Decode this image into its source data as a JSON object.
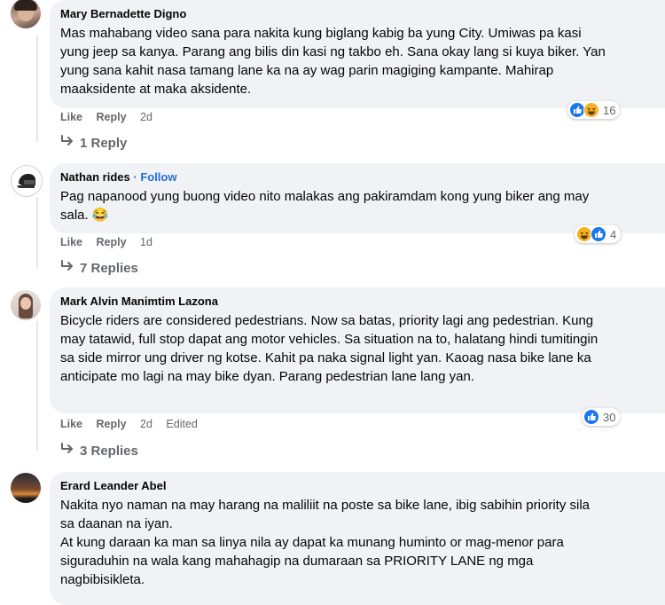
{
  "comments": [
    {
      "author": "Mary Bernadette Digno",
      "follow": "",
      "text": "Mas mahabang video sana para nakita kung biglang kabig ba yung City. Umiwas pa kasi yung jeep sa kanya. Parang ang bilis din kasi ng takbo eh. Sana okay lang si kuya biker. Yan yung sana kahit nasa tamang lane ka na ay wag parin magiging kampante. Mahirap maaksidente at maka aksidente.",
      "like_label": "Like",
      "reply_label": "Reply",
      "time": "2d",
      "edited": "",
      "reaction_count": "16",
      "reactions": [
        "like-icon",
        "haha-icon"
      ],
      "replies_label": "1 Reply"
    },
    {
      "author": "Nathan rides",
      "follow": "· Follow",
      "text": "Pag napanood yung buong video nito malakas ang pakiramdam kong yung biker ang may sala. 😂",
      "like_label": "Like",
      "reply_label": "Reply",
      "time": "1d",
      "edited": "",
      "reaction_count": "4",
      "reactions": [
        "haha-icon",
        "like-icon"
      ],
      "replies_label": "7 Replies"
    },
    {
      "author": "Mark Alvin Manimtim Lazona",
      "follow": "",
      "text": "Bicycle riders are considered pedestrians. Now sa batas, priority lagi ang pedestrian. Kung may tatawid, full stop dapat ang motor vehicles. Sa situation na to, halatang hindi tumitingin sa side mirror ung driver ng kotse. Kahit pa naka signal light yan. Kaoag nasa bike lane ka anticipate mo lagi na may bike dyan. Parang pedestrian lane lang yan.",
      "like_label": "Like",
      "reply_label": "Reply",
      "time": "2d",
      "edited": "Edited",
      "reaction_count": "30",
      "reactions": [
        "like-icon"
      ],
      "replies_label": "3 Replies"
    },
    {
      "author": "Erard Leander Abel",
      "follow": "",
      "text_lines": [
        "Nakita nyo naman na may harang na maliliit na poste sa bike lane, ibig sabihin priority sila sa daanan na iyan.",
        "At kung daraan ka man sa linya nila ay dapat ka munang huminto or mag-menor para siguraduhin na wala kang mahahagip na dumaraan sa PRIORITY LANE ng mga nagbibisikleta."
      ]
    }
  ]
}
